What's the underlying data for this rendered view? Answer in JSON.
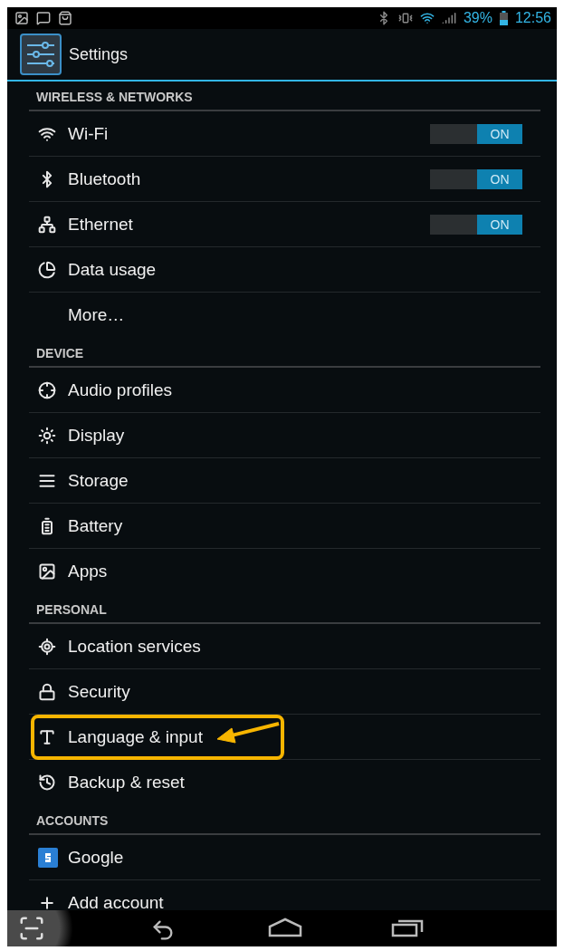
{
  "status_bar": {
    "battery": "39%",
    "time": "12:56"
  },
  "action_bar": {
    "title": "Settings"
  },
  "sections": [
    {
      "header": "WIRELESS & NETWORKS",
      "items": [
        {
          "label": "Wi-Fi",
          "kind": "toggle",
          "toggle": {
            "on": true,
            "label": "ON"
          }
        },
        {
          "label": "Bluetooth",
          "kind": "toggle",
          "toggle": {
            "on": true,
            "label": "ON"
          }
        },
        {
          "label": "Ethernet",
          "kind": "toggle",
          "toggle": {
            "on": true,
            "label": "ON"
          }
        },
        {
          "label": "Data usage",
          "kind": "plain"
        },
        {
          "label": "More…",
          "kind": "plain"
        }
      ]
    },
    {
      "header": "DEVICE",
      "items": [
        {
          "label": "Audio profiles",
          "kind": "plain"
        },
        {
          "label": "Display",
          "kind": "plain"
        },
        {
          "label": "Storage",
          "kind": "plain"
        },
        {
          "label": "Battery",
          "kind": "plain"
        },
        {
          "label": "Apps",
          "kind": "plain"
        }
      ]
    },
    {
      "header": "PERSONAL",
      "items": [
        {
          "label": "Location services",
          "kind": "plain"
        },
        {
          "label": "Security",
          "kind": "plain"
        },
        {
          "label": "Language & input",
          "kind": "plain",
          "highlighted": true
        },
        {
          "label": "Backup & reset",
          "kind": "plain"
        }
      ]
    },
    {
      "header": "ACCOUNTS",
      "items": [
        {
          "label": "Google",
          "kind": "plain"
        },
        {
          "label": "Add account",
          "kind": "plain"
        }
      ]
    }
  ]
}
